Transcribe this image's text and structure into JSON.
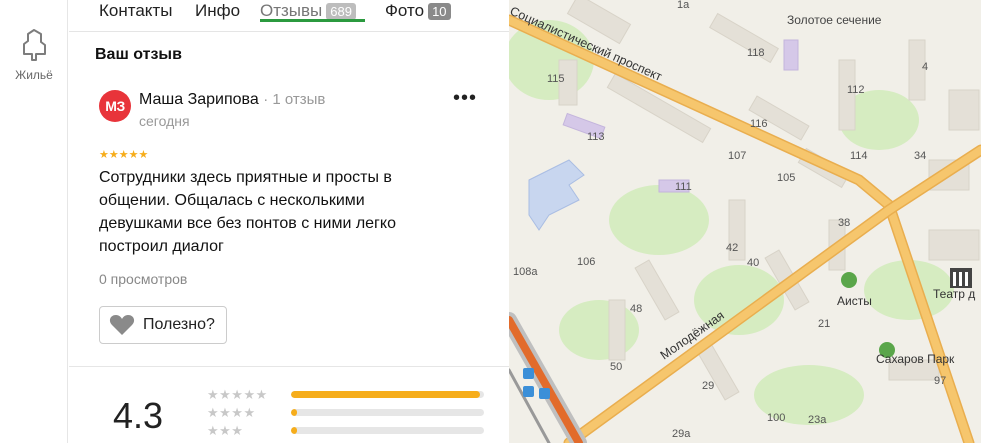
{
  "rail": {
    "items": [
      {
        "label": "Жильё",
        "icon": "housing-icon"
      }
    ]
  },
  "tabs": [
    {
      "label": "Контакты"
    },
    {
      "label": "Инфо"
    },
    {
      "label": "Отзывы",
      "count": "689",
      "active": true
    },
    {
      "label": "Фото",
      "count": "10"
    }
  ],
  "my_review": {
    "title": "Ваш отзыв",
    "avatar_initials": "МЗ",
    "author": "Маша Зарипова",
    "author_meta": "· 1 отзыв",
    "date": "сегодня",
    "stars": "★★★★★",
    "text": "Сотрудники здесь приятные и просты в общении. Общалась с несколькими девушками все без понтов с ними легко построил диалог",
    "views": "0 просмотров",
    "helpful_label": "Полезно?",
    "more_label": "•••"
  },
  "rating": {
    "score": "4.3",
    "distribution": [
      {
        "stars": "★★★★★",
        "fraction": 0.98
      },
      {
        "stars": "★★★★",
        "fraction": 0.03
      },
      {
        "stars": "★★★",
        "fraction": 0.03
      }
    ]
  },
  "map": {
    "street_labels": [
      "Социалистический проспект",
      "Молодёжная"
    ],
    "poi_labels": [
      "Золотое сечение",
      "Аисты",
      "Театр д",
      "Сахаров Парк"
    ],
    "house_numbers": [
      "1a",
      "4",
      "118",
      "115",
      "112",
      "116",
      "113",
      "107",
      "114",
      "34",
      "105",
      "111",
      "38",
      "42",
      "106",
      "108a",
      "40",
      "48",
      "21",
      "50",
      "97",
      "29",
      "100",
      "29a",
      "23a"
    ],
    "colors": {
      "road_major": "#f6c66d",
      "block": "#e8e4dc",
      "green": "#d6ecc1",
      "base": "#f1efe8",
      "rail": "#e26b2b"
    }
  }
}
